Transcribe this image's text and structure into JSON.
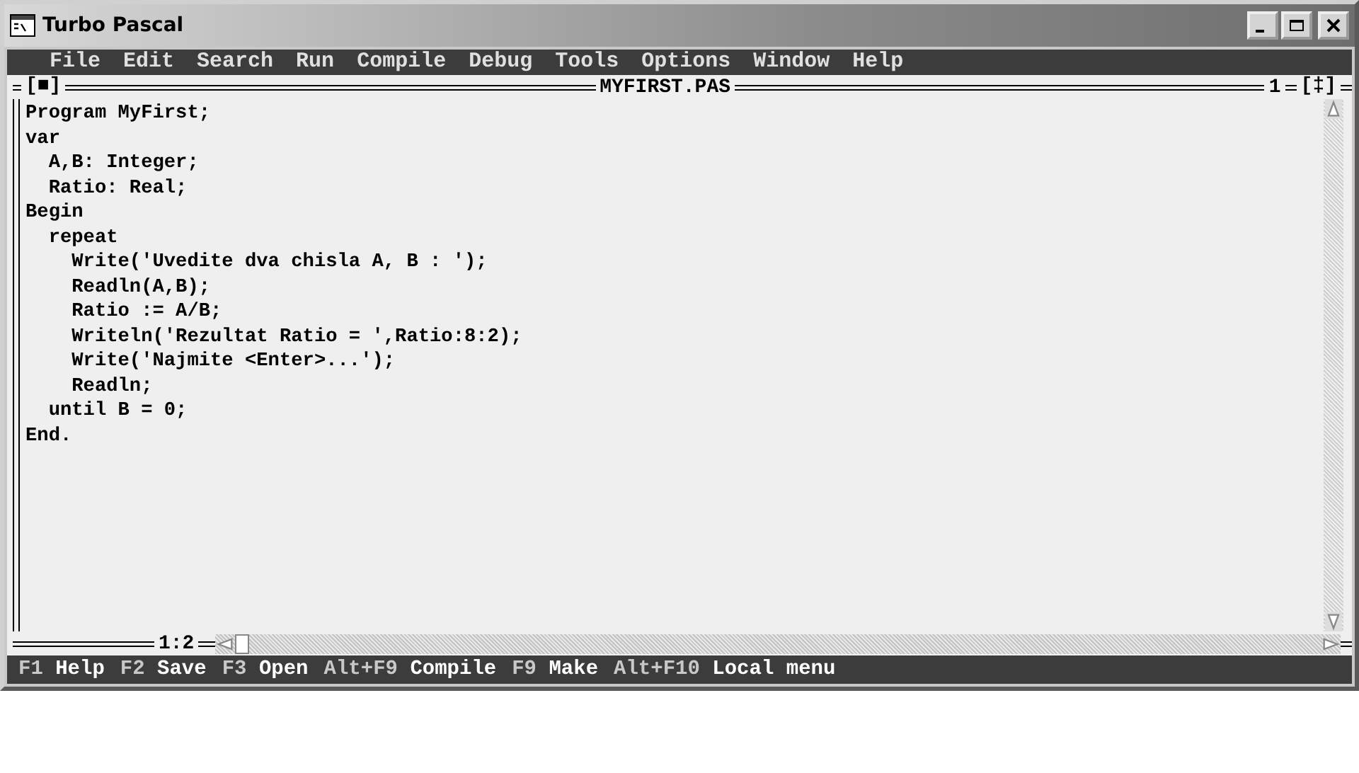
{
  "window": {
    "title": "Turbo Pascal"
  },
  "menu": [
    "File",
    "Edit",
    "Search",
    "Run",
    "Compile",
    "Debug",
    "Tools",
    "Options",
    "Window",
    "Help"
  ],
  "editor": {
    "close_box": "[■]",
    "title": "MYFIRST.PAS",
    "window_number": "1",
    "zoom_box": "[‡]",
    "cursor_position": "1:2",
    "lines": [
      "Program MyFirst;",
      "var",
      "  A,B: Integer;",
      "  Ratio: Real;",
      "Begin",
      "  repeat",
      "    Write('Uvedite dva chisla A, B : ');",
      "    Readln(A,B);",
      "    Ratio := A/B;",
      "    Writeln('Rezultat Ratio = ',Ratio:8:2);",
      "    Write('Najmite <Enter>...');",
      "    Readln;",
      "  until B = 0;",
      "End."
    ]
  },
  "status_bar": [
    {
      "key": "F1",
      "label": "Help"
    },
    {
      "key": "F2",
      "label": "Save"
    },
    {
      "key": "F3",
      "label": "Open"
    },
    {
      "key": "Alt+F9",
      "label": "Compile"
    },
    {
      "key": "F9",
      "label": "Make"
    },
    {
      "key": "Alt+F10",
      "label": "Local menu"
    }
  ]
}
